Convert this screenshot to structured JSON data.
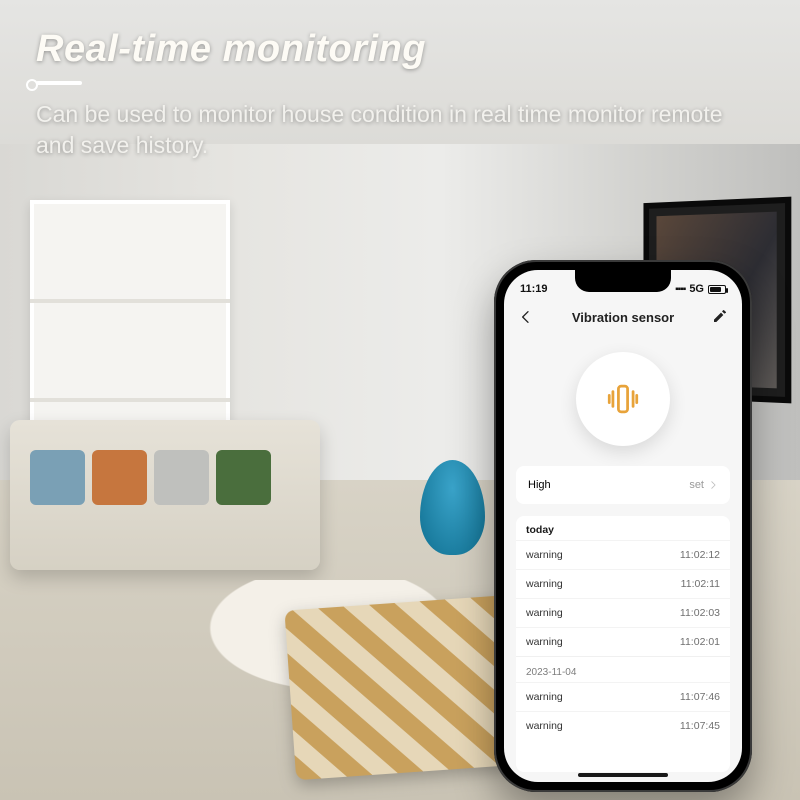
{
  "hero": {
    "title": "Real-time monitoring",
    "description": "Can be used to monitor house condition in real time monitor remote and save history."
  },
  "phone": {
    "status": {
      "time": "11:19",
      "network": "5G"
    },
    "nav": {
      "title": "Vibration sensor"
    },
    "setting": {
      "label": "High",
      "value": "set"
    },
    "history": {
      "today_label": "today",
      "today": [
        {
          "label": "warning",
          "time": "11:02:12"
        },
        {
          "label": "warning",
          "time": "11:02:11"
        },
        {
          "label": "warning",
          "time": "11:02:03"
        },
        {
          "label": "warning",
          "time": "11:02:01"
        }
      ],
      "past_date": "2023-11-04",
      "past": [
        {
          "label": "warning",
          "time": "11:07:46"
        },
        {
          "label": "warning",
          "time": "11:07:45"
        }
      ]
    }
  },
  "colors": {
    "accent": "#e8a33a"
  }
}
